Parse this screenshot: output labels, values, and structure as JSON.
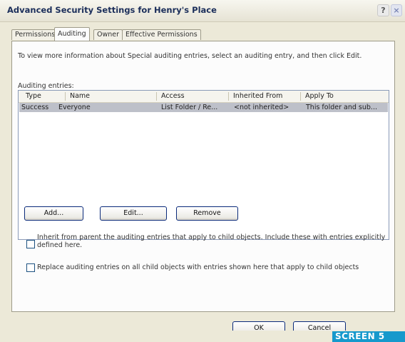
{
  "window": {
    "title": "Advanced Security Settings for Henry's Place",
    "help_glyph": "?",
    "close_glyph": "×"
  },
  "tabs": [
    {
      "label": "Permissions",
      "active": false
    },
    {
      "label": "Auditing",
      "active": true
    },
    {
      "label": "Owner",
      "active": false
    },
    {
      "label": "Effective Permissions",
      "active": false
    }
  ],
  "auditing": {
    "intro_text": "To view more information about Special auditing entries, select an auditing entry, and then click Edit.",
    "list_label": "Auditing entries:",
    "columns": [
      "Type",
      "Name",
      "Access",
      "Inherited From",
      "Apply To"
    ],
    "rows": [
      {
        "type": "Success",
        "name": "Everyone",
        "access": "List Folder / Re...",
        "inherited_from": "<not inherited>",
        "apply_to": "This folder and sub...",
        "selected": true
      }
    ],
    "buttons": {
      "add": "Add...",
      "edit": "Edit...",
      "remove": "Remove"
    },
    "inherit_checkbox": {
      "label": "Inherit from parent the auditing entries that apply to child objects. Include these with entries explicitly defined here.",
      "checked": false
    },
    "replace_checkbox": {
      "label": "Replace auditing entries on all child objects with entries shown here that apply to child objects",
      "checked": false
    }
  },
  "footer": {
    "ok_label": "OK",
    "cancel_label": "Cancel"
  },
  "overlay": {
    "badge_text": "SCREEN 5"
  },
  "colors": {
    "dialog_background": "#ece9d8",
    "selected_row": "#bdc0c9",
    "button_border": "#0a2a7a",
    "badge": "#1699cc",
    "title_text": "#1b2e5a"
  }
}
